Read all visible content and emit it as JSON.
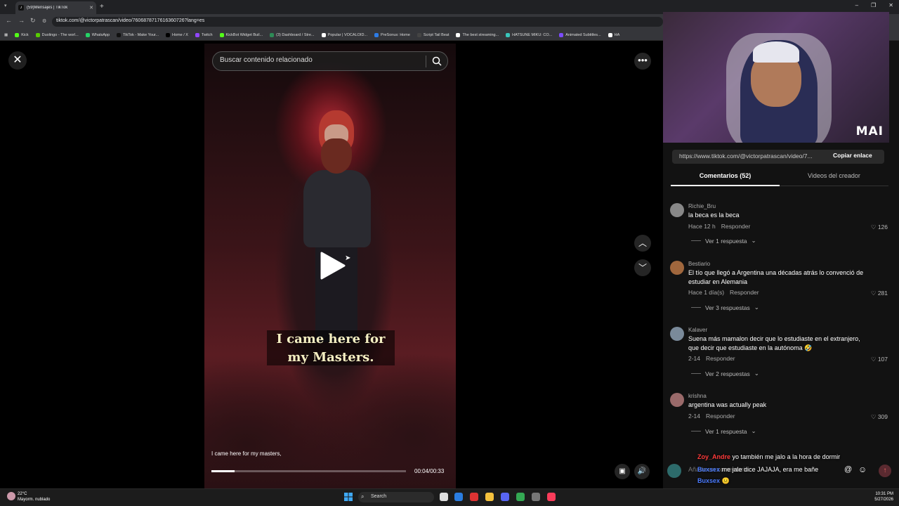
{
  "browser": {
    "tab_title": "(59)Mensajes | TikTok",
    "tab_favicon": "tiktok-icon",
    "url": "tiktok.com/@victorpatrascan/video/7606878717616360726?lang=es",
    "bookmarks": [
      {
        "label": "Kick",
        "color": "#53fc18"
      },
      {
        "label": "Duolingo - The worl...",
        "color": "#58cc02"
      },
      {
        "label": "WhatsApp",
        "color": "#25d366"
      },
      {
        "label": "TikTok - Make Your...",
        "color": "#111111"
      },
      {
        "label": "Home / X",
        "color": "#000000"
      },
      {
        "label": "Twitch",
        "color": "#9146ff"
      },
      {
        "label": "KickBot Widget Buil...",
        "color": "#53fc18"
      },
      {
        "label": "(3) Dashboard / Stre...",
        "color": "#2e8b57"
      },
      {
        "label": "Popular | VOCALOID...",
        "color": "#ffffff"
      },
      {
        "label": "PreSonus: Home",
        "color": "#2c7be5"
      },
      {
        "label": "Script Tail Beat",
        "color": "#444444"
      },
      {
        "label": "The best streaming...",
        "color": "#ffffff"
      },
      {
        "label": "HATSUNE MIKU: CO...",
        "color": "#39c5bb"
      },
      {
        "label": "Animated Subtitles...",
        "color": "#7b4bff"
      },
      {
        "label": "HA",
        "color": "#ffffff"
      }
    ]
  },
  "video": {
    "search_placeholder": "Buscar contenido relacionado",
    "caption_line1": "I came here for",
    "caption_line2": "my Masters.",
    "subtitle": "I came here for my masters,",
    "time": "00:04/00:33",
    "progress": 0.12
  },
  "webcam": {
    "label": "MAI"
  },
  "share": {
    "link": "https://www.tiktok.com/@victorpatrascan/video/7...",
    "copy_label": "Copiar enlace"
  },
  "tabs": {
    "comments": "Comentarios (52)",
    "creator_videos": "Videos del creador"
  },
  "comments": [
    {
      "user": "Richie_Bru",
      "text": "la beca es la beca",
      "time": "Hace 12 h",
      "reply": "Responder",
      "likes": "126",
      "thread": "Ver 1 respuesta",
      "avatar_color": "#888888"
    },
    {
      "user": "Bestiario",
      "text": "El tío que llegó a Argentina una décadas atrás lo convenció de estudiar en Alemania",
      "time": "Hace 1 día(s)",
      "reply": "Responder",
      "likes": "281",
      "thread": "Ver 3 respuestas",
      "avatar_color": "#a0673d"
    },
    {
      "user": "Kalaver",
      "text": "Suena más mamalon decir que lo estudiaste en el extranjero, que decir que estudiaste en la autónoma 🤣",
      "time": "2-14",
      "reply": "Responder",
      "likes": "107",
      "thread": "Ver 2 respuestas",
      "avatar_color": "#7a8a9a"
    },
    {
      "user": "krishna",
      "text": "argentina was actually peak",
      "time": "2-14",
      "reply": "Responder",
      "likes": "309",
      "thread": "Ver 1 respuesta",
      "avatar_color": "#9a6a6a"
    }
  ],
  "chat": {
    "input_placeholder": "Añade un comentario...",
    "messages": [
      {
        "user": "Zoy_Andre",
        "user_color": "#ff3b3b",
        "text": "yo también me jalo a la hora de dormir"
      },
      {
        "user": "Buxsex",
        "user_color": "#4a7bff",
        "text": "me jale dice JAJAJA, era me bañe"
      },
      {
        "user": "Buxsex",
        "user_color": "#4a7bff",
        "text": ""
      }
    ]
  },
  "taskbar": {
    "temp": "22°C",
    "weather": "Mayorm. nublado",
    "search": "Search",
    "time": "10:31 PM",
    "date": "5/27/2026"
  }
}
